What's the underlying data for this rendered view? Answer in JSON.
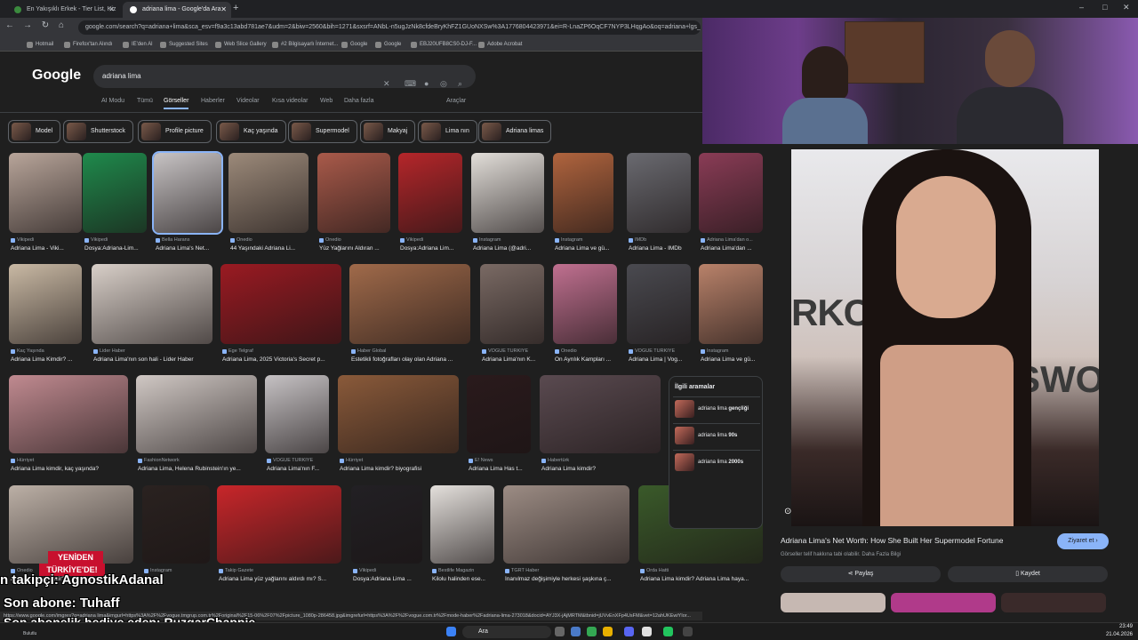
{
  "browser": {
    "tabs": [
      {
        "label": "En Yakışıklı Erkek - Tier List, Kiz"
      },
      {
        "label": "adriana lima - Google'da Ara"
      }
    ],
    "url": "google.com/search?q=adriana+lima&sca_esv=f9a3c13abd781ae7&udm=2&biw=2560&bih=1271&sxsrf=ANbL-n5ugJzNk8cfdeBryKhFZ1GUoNXSw%3A1776804423971&ei=R-LnaZP6OqCF7NYP3LHqgAo&oq=adriana+lgs_lp=E",
    "bookmarks": [
      "Hotmail",
      "Firefox'tan Alındı",
      "IE'den Al",
      "Suggested Sites",
      "Web Slice Gallery",
      "#2 Bilgisayarlı İnternet...",
      "Google",
      "Google",
      "EBJ20UFB8CS0-DJ-F...",
      "Adobe Acrobat"
    ]
  },
  "google": {
    "logo": "Google",
    "query": "adriana lima",
    "tabs": [
      "AI Modu",
      "Tümü",
      "Görseller",
      "Haberler",
      "Videolar",
      "Kısa videolar",
      "Web",
      "Daha fazla",
      "Araçlar"
    ],
    "chips": [
      "Model",
      "Shutterstock",
      "Profile picture",
      "Kaç yaşında",
      "Supermodel",
      "Makyaj",
      "Lima nın",
      "Adriana limas"
    ]
  },
  "results": [
    {
      "src": "Vikipedi",
      "title": "Adriana Lima - Viki...",
      "color": "#b8a59a"
    },
    {
      "src": "Vikipedi",
      "title": "Dosya:Adriana-Lim...",
      "color": "#1f8a4c"
    },
    {
      "src": "Bella Harans",
      "title": "Adriana Lima's Net...",
      "color": "#c7c3c4"
    },
    {
      "src": "Onedio",
      "title": "44 Yaşındaki Adriana Li...",
      "color": "#9c8a7a"
    },
    {
      "src": "Onedio",
      "title": "Yüz Yağlarını Aldıran ...",
      "color": "#a95a4a"
    },
    {
      "src": "Vikipedi",
      "title": "Dosya:Adriana Lim...",
      "color": "#b5262a"
    },
    {
      "src": "Instagram",
      "title": "Adriana Lima (@adri...",
      "color": "#e2ded9"
    },
    {
      "src": "Instagram",
      "title": "Adriana Lima ve gü...",
      "color": "#b0643e"
    },
    {
      "src": "IMDb",
      "title": "Adriana Lima - IMDb",
      "color": "#6a6a70"
    },
    {
      "src": "Adriana Lima'dan o...",
      "title": "Adriana Lima'dan ...",
      "color": "#8a3c56"
    },
    {
      "src": "Kaç Yaşında",
      "title": "Adriana Lima Kimdir? ...",
      "color": "#c9b9a4"
    },
    {
      "src": "Lider Haber",
      "title": "Adriana Lima'nın son hali - Lider Haber",
      "color": "#d8cfc8"
    },
    {
      "src": "Ege Telgraf",
      "title": "Adriana Lima, 2025 Victoria's Secret p...",
      "color": "#9a1a22"
    },
    {
      "src": "Haber Global",
      "title": "Estetikli fotoğrafları olay olan Adriana ...",
      "color": "#a06a4a"
    },
    {
      "src": "VOGUE TÜRKİYE",
      "title": "Adriana Lima'nın K...",
      "color": "#7a6a64"
    },
    {
      "src": "Onedio",
      "title": "On Ayrılık Kampları ...",
      "color": "#c07090"
    },
    {
      "src": "VOGUE TÜRKİYE",
      "title": "Adriana Lima | Vog...",
      "color": "#4a4a50"
    },
    {
      "src": "Instagram",
      "title": "Adriana Lima ve gü...",
      "color": "#b9826a"
    },
    {
      "src": "Hürriyet",
      "title": "Adriana Lima kimdir, kaç yaşında?",
      "color": "#c08a90"
    },
    {
      "src": "FashionNetwork",
      "title": "Adriana Lima, Helena Rubinstein'ın ye...",
      "color": "#d0c8c4"
    },
    {
      "src": "VOGUE TÜRKİYE",
      "title": "Adriana Lima'nın F...",
      "color": "#c6c2c4"
    },
    {
      "src": "Hürriyet",
      "title": "Adriana Lima kimdir? biyografisi",
      "color": "#8a5a3a"
    },
    {
      "src": "E! News",
      "title": "Adriana Lima Has t...",
      "color": "#2a1a1c"
    },
    {
      "src": "Habertürk",
      "title": "Adriana Lima kimdir?",
      "color": "#5a4a50"
    },
    {
      "src": "Onedio",
      "title": "Adriana Lima kimdir?... açar mısın",
      "color": "#bcb0a6"
    },
    {
      "src": "Instagram",
      "title": "",
      "color": "#2a2220"
    },
    {
      "src": "Takip Gazete",
      "title": "Adriana Lima yüz yağlarını aldırdı mı? S...",
      "color": "#c8262a"
    },
    {
      "src": "Vikipedi",
      "title": "Dosya:Adriana Lima ...",
      "color": "#222024"
    },
    {
      "src": "Bestlife Magazin",
      "title": "Kilolu halinden ese...",
      "color": "#e4e0dc"
    },
    {
      "src": "TGRT Haber",
      "title": "İnanılmaz değişimiyle herkesi şaşkına ç...",
      "color": "#9c8c84"
    },
    {
      "src": "Orda Hatti",
      "title": "Adriana Lima kimdir? Adriana Lima haya...",
      "color": "#3a5a2a"
    }
  ],
  "related": {
    "heading": "İlgili aramalar",
    "items": [
      {
        "prefix": "adriana lima ",
        "bold": "gençliği"
      },
      {
        "prefix": "adriana lima ",
        "bold": "90s"
      },
      {
        "prefix": "adriana lima ",
        "bold": "2000s"
      }
    ]
  },
  "panel": {
    "title": "Adriana Lima's Net Worth: How She Built Her Supermodel Fortune",
    "visit": "Ziyaret et",
    "note": "Görseller telif hakkına tabi olabilir. Daha Fazla Bilgi",
    "share": "Paylaş",
    "save": "Kaydet",
    "bg_text_left": "RKCICLE.",
    "bg_text_right": "SWOR"
  },
  "overlay": {
    "line1": "n takipçi: AgnostikAdanal",
    "line2": "Son abone: Tuhaff",
    "line3": "Son abonelik hediye eden: RuzgarChappie",
    "badge1": "YENİDEN",
    "badge2": "TÜRKİYE'DE!"
  },
  "status_url": "https://www.google.com/imgres?q=adriana lima&imgurl=https%3A%2F%2Fvogue.tmgrup.com.tr%2Foriginal%2F15-06%2F07%2Fpicture_1080p-286458.jpg&imgrefurl=https%3A%2F%2Fvogue.com.tr%2Fmode-haber%2Fadriana-lima-273018&docid=AYJ3X-jAjMRTM&tbnid=jUVvEnXFp4UsFM&vet=12ahUKEwiYIor...",
  "taskbar": {
    "search": "Ara",
    "time": "23:49",
    "date": "21.04.2026",
    "weather": "Bulutlu"
  }
}
